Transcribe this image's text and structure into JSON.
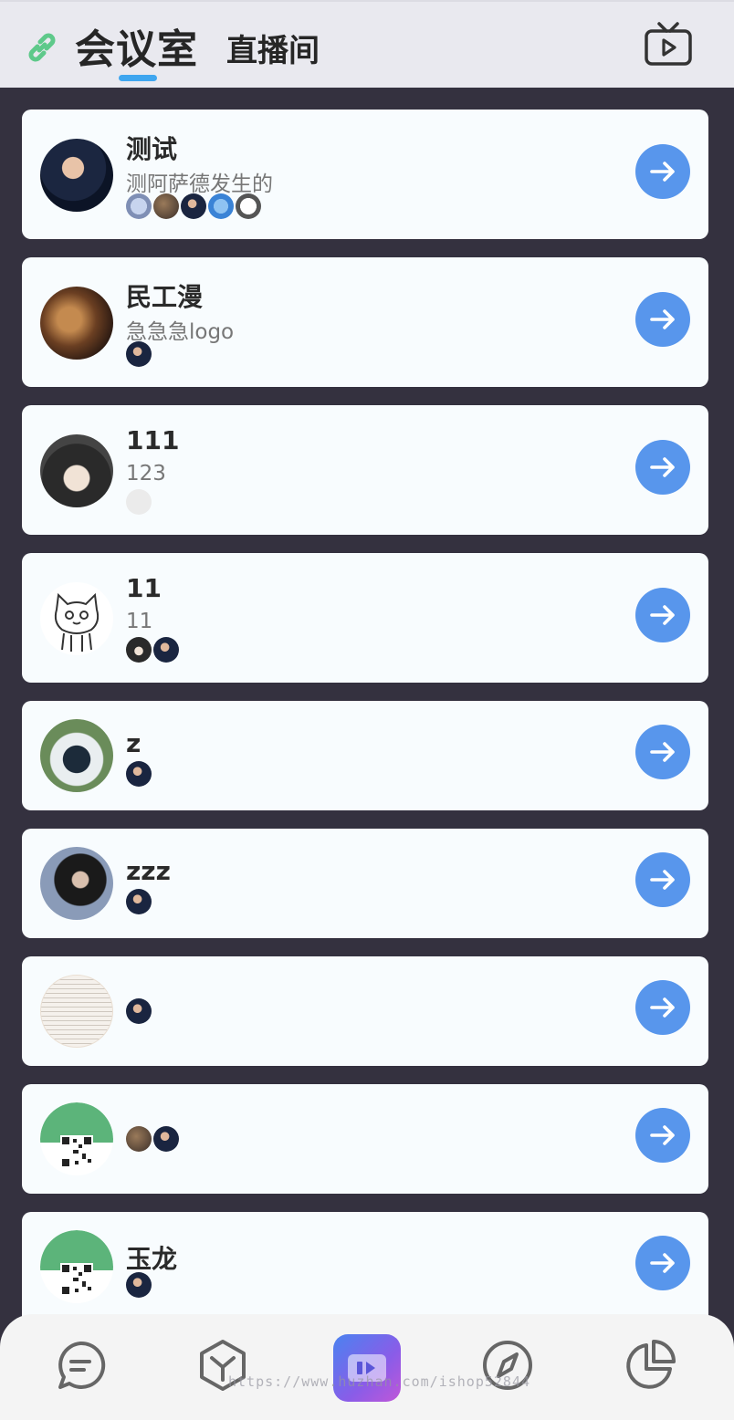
{
  "header": {
    "tab_active": "会议室",
    "tab_inactive": "直播间",
    "icons": {
      "left": "link-icon",
      "right": "tv-play-icon"
    },
    "colors": {
      "accent": "#3fa6ef",
      "link_icon": "#5ec98a"
    }
  },
  "rooms": [
    {
      "title": "测试",
      "subtitle": "测阿萨德发生的",
      "members": 5
    },
    {
      "title": "民工漫",
      "subtitle": "急急急logo",
      "members": 1
    },
    {
      "title": "111",
      "subtitle": "123",
      "members": 1
    },
    {
      "title": "11",
      "subtitle": "11",
      "members": 2
    },
    {
      "title": "z",
      "subtitle": "",
      "members": 1
    },
    {
      "title": "zzz",
      "subtitle": "",
      "members": 1
    },
    {
      "title": "",
      "subtitle": "",
      "members": 1
    },
    {
      "title": "",
      "subtitle": "",
      "members": 2
    },
    {
      "title": "玉龙",
      "subtitle": "",
      "members": 1
    }
  ],
  "tabbar": {
    "items": [
      "chat-icon",
      "cube-icon",
      "video-meeting-icon",
      "compass-icon",
      "pie-chart-icon"
    ],
    "active": "video-meeting-icon"
  },
  "watermark": "https://www.huzhan.com/ishop52844"
}
